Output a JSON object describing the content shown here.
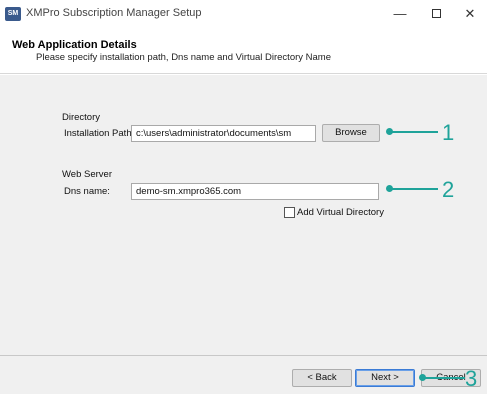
{
  "window": {
    "app_icon_text": "SM",
    "title": "XMPro Subscription Manager Setup",
    "minimize_glyph": "—",
    "close_glyph": "✕"
  },
  "header": {
    "title": "Web Application Details",
    "subtitle": "Please specify installation path, Dns name and Virtual Directory Name"
  },
  "directory": {
    "group_label": "Directory",
    "installation_path_label": "Installation Path:",
    "installation_path_value": "c:\\users\\administrator\\documents\\sm",
    "browse_label": "Browse"
  },
  "web_server": {
    "group_label": "Web Server",
    "dns_label": "Dns name:",
    "dns_value": "demo-sm.xmpro365.com",
    "virtual_directory_label": "Add Virtual Directory",
    "virtual_directory_checked": false
  },
  "footer": {
    "back_label": "< Back",
    "next_label": "Next >",
    "cancel_label": "Cancel"
  },
  "callouts": {
    "one": "1",
    "two": "2",
    "three": "3",
    "color": "#1fa39a"
  }
}
